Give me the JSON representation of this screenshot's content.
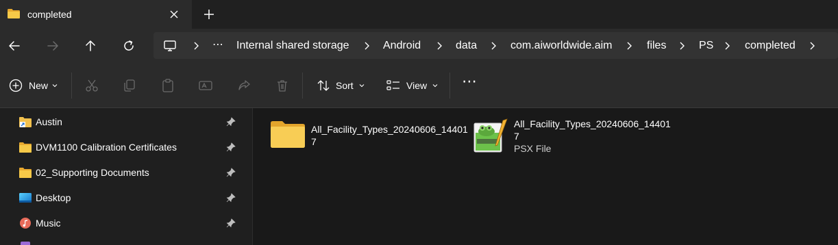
{
  "tab": {
    "title": "completed",
    "close_icon": "close-icon",
    "new_tab_icon": "plus-icon"
  },
  "nav": {
    "back": "back-arrow-icon",
    "forward": "forward-arrow-icon",
    "up": "up-arrow-icon",
    "refresh": "refresh-icon"
  },
  "breadcrumb": {
    "overflow": "⋯",
    "items": [
      "Internal shared storage",
      "Android",
      "data",
      "com.aiworldwide.aim",
      "files",
      "PS",
      "completed"
    ]
  },
  "toolbar": {
    "new_label": "New",
    "sort_label": "Sort",
    "view_label": "View",
    "more": "⋯"
  },
  "sidebar": {
    "items": [
      {
        "label": "Austin",
        "icon": "shortcut-folder-icon"
      },
      {
        "label": "DVM1100 Calibration Certificates",
        "icon": "folder-icon"
      },
      {
        "label": "02_Supporting Documents",
        "icon": "folder-icon"
      },
      {
        "label": "Desktop",
        "icon": "desktop-icon"
      },
      {
        "label": "Music",
        "icon": "music-icon"
      }
    ]
  },
  "files": [
    {
      "name_line1": "All_Facility_Types_20240606_14401",
      "name_line2": "7",
      "type": "",
      "icon": "folder-icon"
    },
    {
      "name_line1": "All_Facility_Types_20240606_14401",
      "name_line2": "7",
      "type": "PSX File",
      "icon": "psx-file-icon"
    }
  ],
  "colors": {
    "folder": "#f2c14e",
    "accent": "#4cc2ff",
    "background": "#191919"
  }
}
